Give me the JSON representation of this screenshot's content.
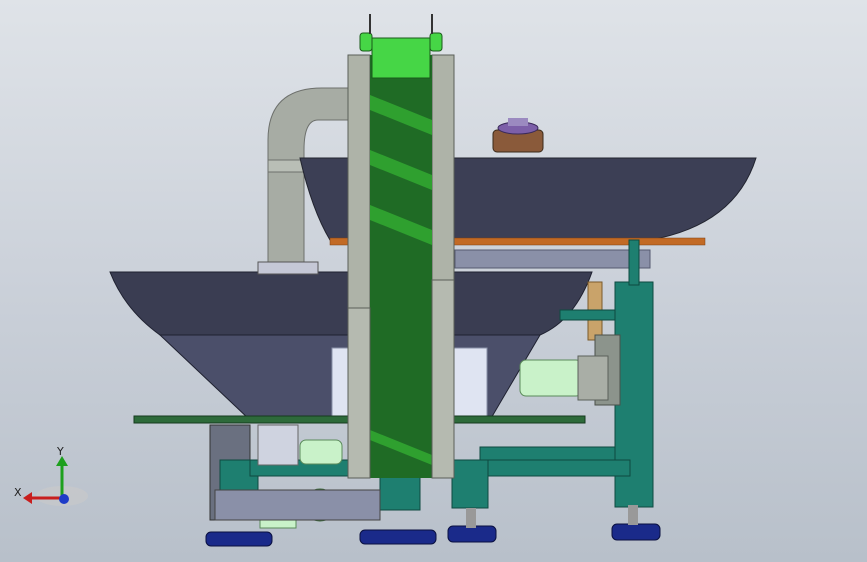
{
  "viewport": {
    "background_top": "#dfe3e8",
    "background_bottom": "#b8c0ca"
  },
  "model": {
    "colors": {
      "conveyor_green": "#2fa02f",
      "bright_green": "#46d646",
      "steel_gray": "#8c948c",
      "hopper_dark": "#3c3f55",
      "frame_teal": "#1e7f70",
      "plate_orange": "#c26a25",
      "duct_gray": "#a7aca4",
      "pad_blue": "#1a2a8a",
      "motor_green": "#c9f2c9"
    }
  },
  "triad": {
    "x_label": "X",
    "y_label": "Y",
    "x_color": "#c81e1e",
    "y_color": "#1ea01e",
    "z_color": "#1e3cc8"
  }
}
